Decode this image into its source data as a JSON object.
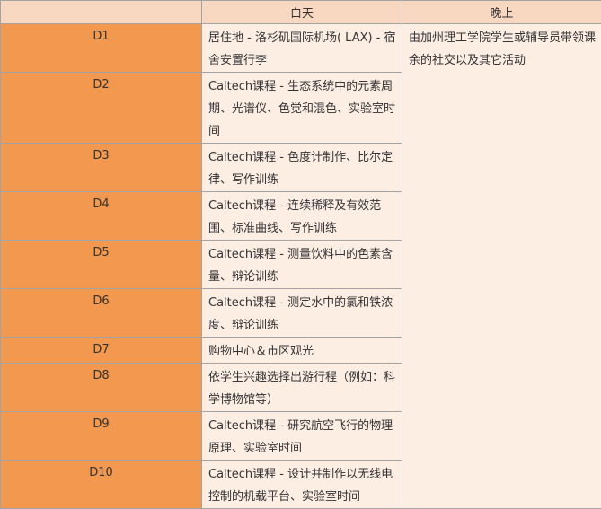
{
  "header": {
    "col_day": "",
    "col_daytime": "白天",
    "col_evening": "晚上"
  },
  "rows": [
    {
      "day": "D1",
      "daytime": "居住地 - 洛杉矶国际机场( LAX) - 宿舍安置行李"
    },
    {
      "day": "D2",
      "daytime": "Caltech课程 - 生态系统中的元素周期、光谱仪、色觉和混色、实验室时间"
    },
    {
      "day": "D3",
      "daytime": "Caltech课程 - 色度计制作、比尔定律、写作训练"
    },
    {
      "day": "D4",
      "daytime": "Caltech课程 - 连续稀释及有效范围、标准曲线、写作训练"
    },
    {
      "day": "D5",
      "daytime": "Caltech课程 - 测量饮料中的色素含量、辩论训练"
    },
    {
      "day": "D6",
      "daytime": "Caltech课程 - 测定水中的氯和铁浓度、辩论训练"
    },
    {
      "day": "D7",
      "daytime": "购物中心＆市区观光"
    },
    {
      "day": "D8",
      "daytime": "依学生兴趣选择出游行程（例如：科学博物馆等）"
    },
    {
      "day": "D9",
      "daytime": "Caltech课程 - 研究航空飞行的物理原理、实验室时间"
    },
    {
      "day": "D10",
      "daytime": "Caltech课程 - 设计并制作以无线电控制的机载平台、实验室时间"
    }
  ],
  "evening": "由加州理工学院学生或辅导员带领课余的社交以及其它活动",
  "colors": {
    "header_bg": "#f9d8c1",
    "day_cell_bg": "#f2994f",
    "content_bg": "#fdeee4",
    "border": "#a3a3a3"
  }
}
